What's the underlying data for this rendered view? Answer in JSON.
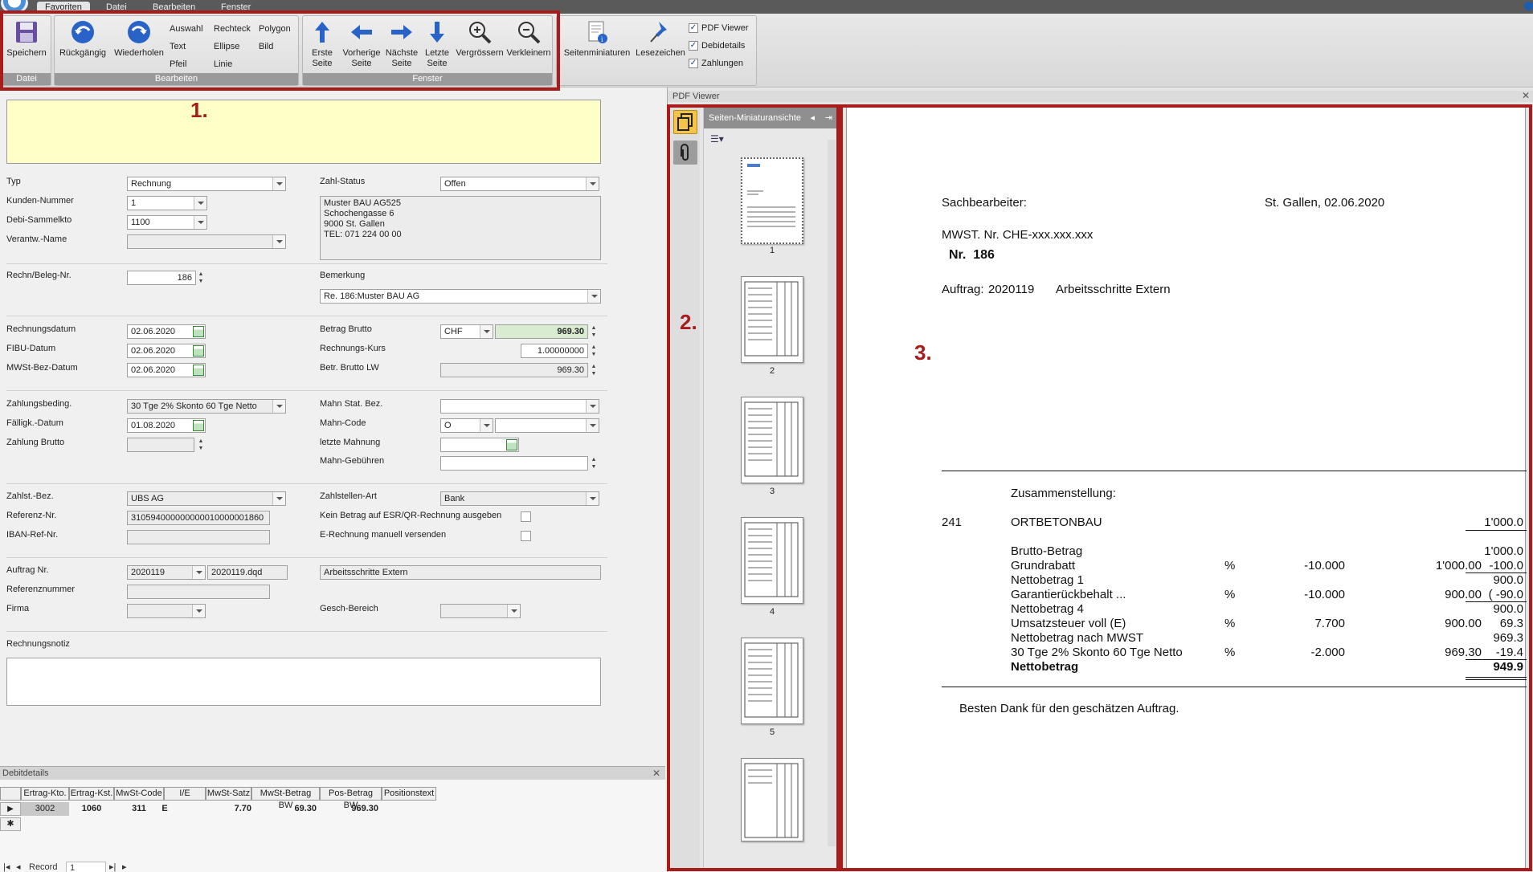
{
  "menu": {
    "tabs": [
      "Favoriten",
      "Datei",
      "Bearbeiten",
      "Fenster"
    ]
  },
  "ribbon": {
    "datei": {
      "save": "Speichern",
      "group": "Datei"
    },
    "bearbeiten": {
      "undo": "Rückgängig",
      "redo": "Wiederholen",
      "tools": [
        "Auswahl",
        "Rechteck",
        "Polygon",
        "Text",
        "Ellipse",
        "Bild",
        "Pfeil",
        "Linie"
      ],
      "group": "Bearbeiten"
    },
    "fenster": {
      "first": [
        "Erste",
        "Seite"
      ],
      "prev": [
        "Vorherige",
        "Seite"
      ],
      "next": [
        "Nächste",
        "Seite"
      ],
      "last": [
        "Letzte",
        "Seite"
      ],
      "zoomin": "Vergrössern",
      "zoomout": "Verkleinern",
      "thumbs": "Seitenminiaturen",
      "bookmarks": "Lesezeichen",
      "group": "Fenster",
      "checks": [
        "PDF Viewer",
        "Debidetails",
        "Zahlungen"
      ]
    }
  },
  "form": {
    "typ": {
      "label": "Typ",
      "value": "Rechnung"
    },
    "kunden": {
      "label": "Kunden-Nummer",
      "value": "1"
    },
    "debi": {
      "label": "Debi-Sammelkto",
      "value": "1100"
    },
    "verantw": {
      "label": "Verantw.-Name",
      "value": ""
    },
    "zahlstatus": {
      "label": "Zahl-Status",
      "value": "Offen"
    },
    "address": [
      "Muster BAU AG525",
      "Schochengasse 6",
      "9000 St. Gallen",
      "TEL: 071 224 00 00"
    ],
    "rechn": {
      "label": "Rechn/Beleg-Nr.",
      "value": "186"
    },
    "bemerkung": {
      "label": "Bemerkung",
      "value": "Re. 186:Muster BAU AG"
    },
    "rdatum": {
      "label": "Rechnungsdatum",
      "value": "02.06.2020"
    },
    "fibu": {
      "label": "FIBU-Datum",
      "value": "02.06.2020"
    },
    "mwst": {
      "label": "MWSt-Bez-Datum",
      "value": "02.06.2020"
    },
    "brutto": {
      "label": "Betrag Brutto",
      "currency": "CHF",
      "value": "969.30"
    },
    "kurs": {
      "label": "Rechnungs-Kurs",
      "value": "1.00000000"
    },
    "bruttolw": {
      "label": "Betr. Brutto LW",
      "value": "969.30"
    },
    "zahlungsbed": {
      "label": "Zahlungsbeding.",
      "value": "30 Tge 2% Skonto 60 Tge Netto"
    },
    "faellig": {
      "label": "Fälligk.-Datum",
      "value": "01.08.2020"
    },
    "zbrutto": {
      "label": "Zahlung Brutto",
      "value": ""
    },
    "mahnstat": {
      "label": "Mahn Stat. Bez.",
      "value": ""
    },
    "mahncode": {
      "label": "Mahn-Code",
      "value": "O"
    },
    "letztemahn": {
      "label": "letzte Mahnung",
      "value": ""
    },
    "mahngeb": {
      "label": "Mahn-Gebühren",
      "value": ""
    },
    "zahlst": {
      "label": "Zahlst.-Bez.",
      "value": "UBS AG"
    },
    "referenz": {
      "label": "Referenz-Nr.",
      "value": "310594000000000010000001860"
    },
    "iban": {
      "label": "IBAN-Ref-Nr.",
      "value": ""
    },
    "zahlart": {
      "label": "Zahlstellen-Art",
      "value": "Bank"
    },
    "kein": {
      "label": "Kein Betrag auf ESR/QR-Rechnung ausgeben"
    },
    "erech": {
      "label": "E-Rechnung manuell versenden"
    },
    "auftrag": {
      "label": "Auftrag Nr.",
      "value": "2020119",
      "file": "2020119.dqd",
      "desc": "Arbeitsschritte Extern"
    },
    "refnum": {
      "label": "Referenznummer",
      "value": ""
    },
    "firma": {
      "label": "Firma",
      "value": ""
    },
    "gesch": {
      "label": "Gesch-Bereich",
      "value": ""
    },
    "notiz": {
      "label": "Rechnungsnotiz",
      "value": ""
    }
  },
  "debit": {
    "title": "Debitdetails",
    "headers": [
      "Ertrag-Kto.",
      "Ertrag-Kst.",
      "MwSt-Code",
      "I/E",
      "MwSt-Satz",
      "MwSt-Betrag BW",
      "Pos-Betrag BW",
      "Positionstext"
    ],
    "row": [
      "3002",
      "1060",
      "311",
      "E",
      "7.70",
      "69.30",
      "969.30",
      ""
    ],
    "nav": {
      "label": "Record",
      "value": "1"
    }
  },
  "pdf": {
    "title": "PDF Viewer",
    "thumb_header": "Seiten-Miniaturansichte",
    "pages": [
      "1",
      "2",
      "3",
      "4",
      "5"
    ],
    "doc": {
      "sachbearbeiter": "Sachbearbeiter:",
      "ort": "St. Gallen, 02.06.2020",
      "mwst": "MWST. Nr. CHE-xxx.xxx.xxx",
      "nr": "Nr.  186",
      "auftrag_label": "Auftrag:",
      "auftrag_nr": "2020119",
      "auftrag_desc": "Arbeitsschritte Extern",
      "zusammen": "Zusammenstellung:",
      "pos_nr": "241",
      "pos_name": "ORTBETONBAU",
      "pos_val": "1'000.0",
      "rows": [
        {
          "name": "Brutto-Betrag",
          "pct": "",
          "rate": "",
          "base": "",
          "val": "1'000.0"
        },
        {
          "name": "Grundrabatt",
          "pct": "%",
          "rate": "-10.000",
          "base": "1'000.00",
          "val": "-100.0"
        },
        {
          "name": "Nettobetrag 1",
          "pct": "",
          "rate": "",
          "base": "",
          "val": "900.0"
        },
        {
          "name": "Garantierückbehalt ...",
          "pct": "%",
          "rate": "-10.000",
          "base": "900.00",
          "val": "(    -90.0"
        },
        {
          "name": "Nettobetrag 4",
          "pct": "",
          "rate": "",
          "base": "",
          "val": "900.0"
        },
        {
          "name": "Umsatzsteuer voll (E)",
          "pct": "%",
          "rate": "7.700",
          "base": "900.00",
          "val": "69.3"
        },
        {
          "name": "Nettobetrag nach MWST",
          "pct": "",
          "rate": "",
          "base": "",
          "val": "969.3"
        },
        {
          "name": "30 Tge 2% Skonto 60 Tge Netto",
          "pct": "%",
          "rate": "-2.000",
          "base": "969.30",
          "val": "-19.4"
        },
        {
          "name": "Nettobetrag",
          "pct": "",
          "rate": "",
          "base": "",
          "val": "949.9"
        }
      ],
      "dank": "Besten Dank für den geschätzen Auftrag."
    }
  },
  "annotations": [
    "1.",
    "2.",
    "3."
  ]
}
